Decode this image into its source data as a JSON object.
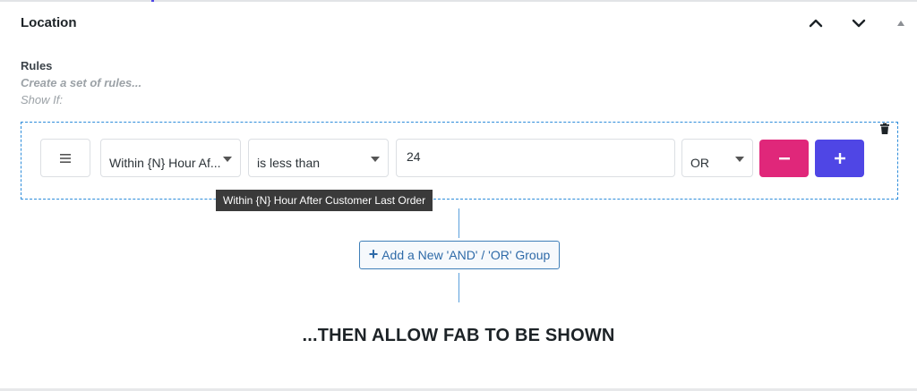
{
  "panel": {
    "title": "Location"
  },
  "rules": {
    "label": "Rules",
    "description": "Create a set of rules...",
    "show_if": "Show If:"
  },
  "rule_row": {
    "field_value": "Within {N} Hour Af...",
    "operator_value": "is less than",
    "input_value": "24",
    "logic_value": "OR",
    "minus_label": "−",
    "plus_label": "+"
  },
  "tooltip": {
    "text": "Within {N} Hour After Customer Last Order"
  },
  "add_group": {
    "plus": "+",
    "label": "Add a New 'AND' / 'OR' Group"
  },
  "footer_text": "...THEN ALLOW FAB TO BE SHOWN",
  "colors": {
    "minus_button": "#e0277a",
    "plus_button": "#4f46e5",
    "rule_border": "#2e8ddb",
    "add_group_text": "#2e6aa8"
  },
  "icons": {
    "header": [
      "chevron-up-icon",
      "chevron-down-icon",
      "triangle-up-icon"
    ],
    "drag": "hamburger-icon",
    "delete": "trash-icon"
  }
}
